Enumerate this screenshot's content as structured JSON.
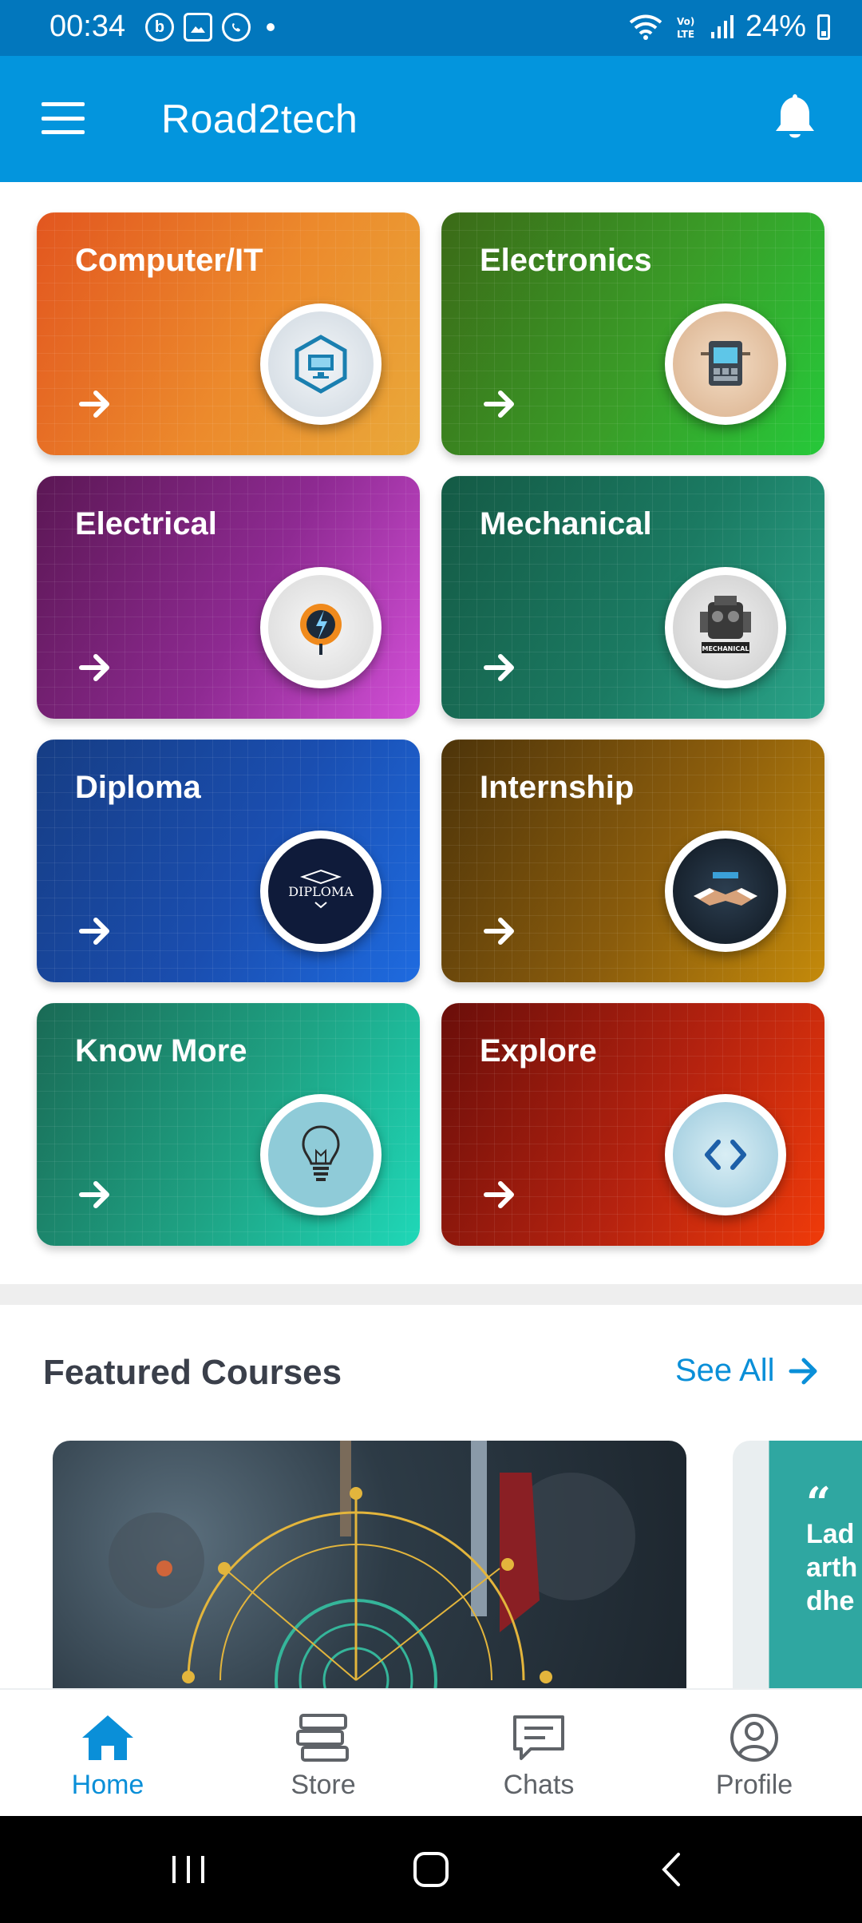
{
  "status_bar": {
    "time": "00:34",
    "battery": "24%",
    "icons": [
      "b-icon",
      "gallery-icon",
      "whatsapp-icon",
      "dot",
      "wifi-icon",
      "volte-icon",
      "signal-icon",
      "battery-icon"
    ]
  },
  "app_bar": {
    "title": "Road2tech",
    "menu_icon": "hamburger-menu-icon",
    "bell_icon": "notification-bell-icon"
  },
  "categories": [
    {
      "title": "Computer/IT",
      "icon": "computer-icon"
    },
    {
      "title": "Electronics",
      "icon": "electronics-icon"
    },
    {
      "title": "Electrical",
      "icon": "electrical-icon"
    },
    {
      "title": "Mechanical",
      "icon": "mechanical-icon",
      "badge_text": "MECHANICAL"
    },
    {
      "title": "Diploma",
      "icon": "diploma-icon",
      "badge_text": "DIPLOMA"
    },
    {
      "title": "Internship",
      "icon": "handshake-icon"
    },
    {
      "title": "Know More",
      "icon": "lightbulb-icon"
    },
    {
      "title": "Explore",
      "icon": "code-brackets-icon"
    }
  ],
  "featured": {
    "title": "Featured Courses",
    "see_all": "See All",
    "course_2_text": "Lad arth dhe"
  },
  "bottom_nav": [
    {
      "label": "Home",
      "active": true
    },
    {
      "label": "Store",
      "active": false
    },
    {
      "label": "Chats",
      "active": false
    },
    {
      "label": "Profile",
      "active": false
    }
  ],
  "colors": {
    "primary": "#0395dd",
    "status": "#0277bd",
    "accent": "#0a8fd8"
  }
}
